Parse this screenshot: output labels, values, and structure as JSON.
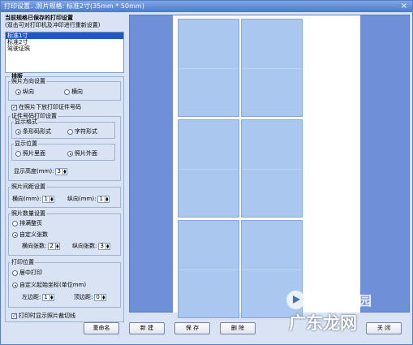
{
  "window": {
    "title": "打印设置...照片规格: 标准2寸(35mm * 50mm)",
    "close_glyph": "×"
  },
  "header": {
    "line1": "当前规格已保存的打印设置",
    "line2": "(双击可对打印机及冲印进行重新设置)"
  },
  "presets": {
    "items": [
      "标准1寸",
      "标准2寸",
      "驾驶证照"
    ],
    "selected_index": 0
  },
  "layout": {
    "title": "排版",
    "orientation": {
      "title": "照片方向设置",
      "portrait": "纵向",
      "landscape": "横向",
      "selected": "portrait"
    },
    "print_id_checkbox": {
      "label": "在照片下放打印证件号码",
      "checked": true
    },
    "id_print": {
      "title": "证件号码打印设置",
      "display_format": {
        "title": "显示格式",
        "barcode": "条形码形式",
        "text": "字符形式",
        "selected": "barcode"
      },
      "display_position": {
        "title": "显示位置",
        "inside": "照片里面",
        "outside": "照片外面",
        "selected": "outside"
      },
      "height_label": "显示高度(mm):",
      "height_value": "3"
    },
    "spacing": {
      "title": "照片间距设置",
      "h_label": "横向(mm):",
      "h_value": "1",
      "v_label": "纵向(mm):",
      "v_value": "1"
    },
    "count": {
      "title": "照片数量设置",
      "full": "排满整页",
      "custom": "自定义张数",
      "selected": "custom",
      "h_label": "横向张数:",
      "h_value": "2",
      "v_label": "纵向张数:",
      "v_value": "3"
    },
    "position": {
      "title": "打印位置",
      "center": "居中打印",
      "custom": "自定义起始坐标(单位mm)",
      "selected": "custom",
      "left_label": "左边距:",
      "left_value": "1",
      "top_label": "顶边距:",
      "top_value": "0"
    },
    "print_border_checkbox": {
      "label": "打印时显示照片裁切线",
      "checked": true
    }
  },
  "buttons": {
    "rename": "重命名",
    "new": "新 建",
    "save": "保 存",
    "delete": "删 除",
    "close": "关 闭"
  },
  "preview": {
    "photo_cols": 3,
    "photo_rows": 3,
    "page_color": "#ffffff",
    "bg_color": "#6f8fd8",
    "photo_color": "#aac7f0"
  },
  "watermark": {
    "cn": "当下软件园",
    "url": "广东龙网"
  }
}
